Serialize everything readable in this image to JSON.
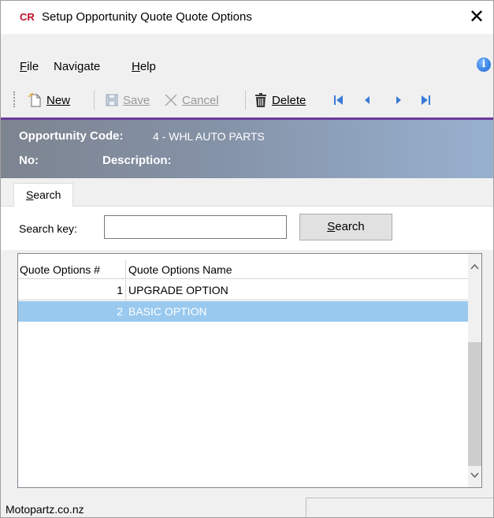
{
  "window": {
    "app_badge": "CR",
    "title": "Setup Opportunity Quote Quote Options",
    "close_glyph": "✕"
  },
  "menu": {
    "items": [
      "File",
      "Navigate",
      "Help"
    ],
    "info_glyph": "i"
  },
  "toolbar": {
    "new_label": "New",
    "save_label": "Save",
    "cancel_label": "Cancel",
    "delete_label": "Delete"
  },
  "header": {
    "opportunity_code_label": "Opportunity Code:",
    "opportunity_code_value": "4 - WHL AUTO PARTS",
    "no_label": "No:",
    "description_label": "Description:"
  },
  "tabs": [
    "Search"
  ],
  "search": {
    "key_label": "Search key:",
    "key_value": "",
    "button_label": "Search"
  },
  "grid": {
    "columns": [
      "Quote Options #",
      "Quote Options Name"
    ],
    "rows": [
      {
        "num": "1",
        "name": "UPGRADE OPTION",
        "selected": false
      },
      {
        "num": "2",
        "name": "BASIC OPTION",
        "selected": true
      }
    ]
  },
  "status": {
    "left_text": "Motopartz.co.nz"
  },
  "colors": {
    "badge": "#c0102a",
    "accent_line": "#6d3b9a",
    "selection": "#99c9ef",
    "nav_arrows": "#3a7bd5"
  }
}
